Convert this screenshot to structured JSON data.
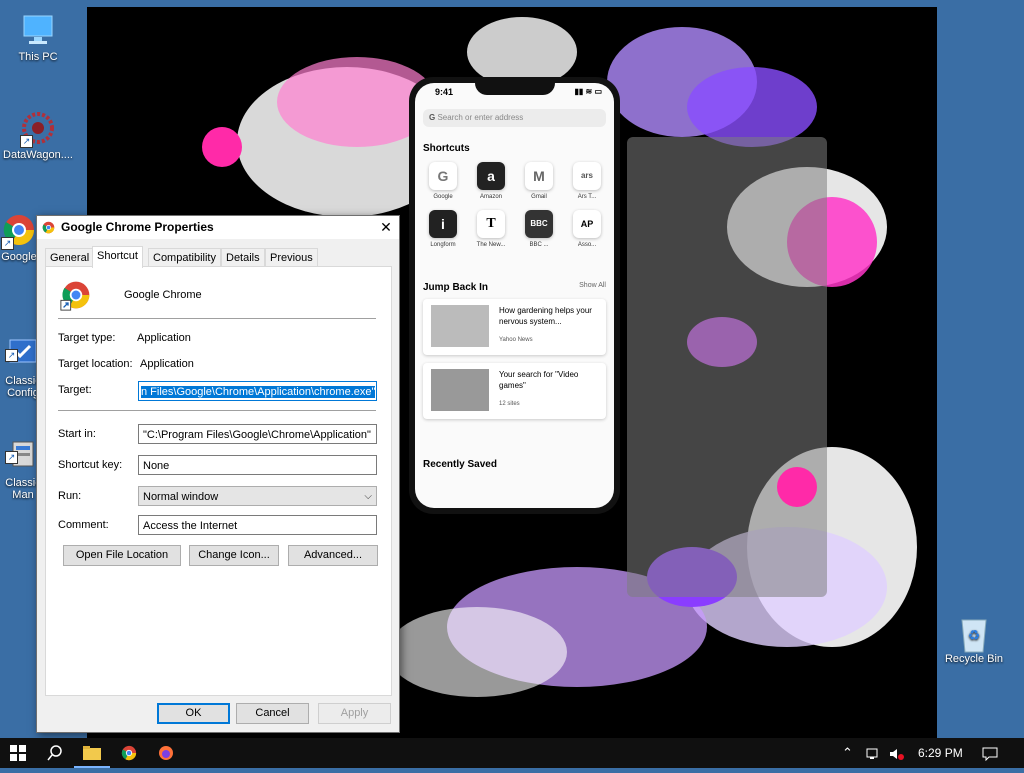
{
  "desktop": {
    "icons": [
      {
        "label": "This PC"
      },
      {
        "label": "DataWagon...."
      },
      {
        "label": "Google"
      },
      {
        "label": "Classic\nConfig"
      },
      {
        "label": "Classic\nMan"
      },
      {
        "label": "Recycle Bin"
      }
    ]
  },
  "phone": {
    "time": "9:41",
    "search_placeholder": "Search or enter address",
    "shortcuts_heading": "Shortcuts",
    "shortcuts": [
      {
        "glyph": "G",
        "label": "Google"
      },
      {
        "glyph": "a",
        "label": "Amazon"
      },
      {
        "glyph": "M",
        "label": "Gmail"
      },
      {
        "glyph": "ars",
        "label": "Ars T..."
      },
      {
        "glyph": "i",
        "label": "Longform"
      },
      {
        "glyph": "T",
        "label": "The New..."
      },
      {
        "glyph": "BBC",
        "label": "BBC ..."
      },
      {
        "glyph": "AP",
        "label": "Asso..."
      }
    ],
    "jump_back_heading": "Jump Back In",
    "show_all": "Show All",
    "cards": [
      {
        "title": "How gardening helps your nervous system...",
        "source": "Yahoo News"
      },
      {
        "title": "Your search for \"Video games\"",
        "source": "12 sites"
      }
    ],
    "recently_saved": "Recently Saved"
  },
  "dialog": {
    "title": "Google Chrome Properties",
    "tabs": [
      "General",
      "Shortcut",
      "Compatibility",
      "Details",
      "Previous Versions"
    ],
    "active_tab": "Shortcut",
    "app_name": "Google Chrome",
    "target_type_label": "Target type:",
    "target_type_value": "Application",
    "target_location_label": "Target location:",
    "target_location_value": "Application",
    "target_label": "Target:",
    "target_value": "n Files\\Google\\Chrome\\Application\\chrome.exe\"",
    "start_in_label": "Start in:",
    "start_in_value": "\"C:\\Program Files\\Google\\Chrome\\Application\"",
    "shortcut_key_label": "Shortcut key:",
    "shortcut_key_value": "None",
    "run_label": "Run:",
    "run_value": "Normal window",
    "comment_label": "Comment:",
    "comment_value": "Access the Internet",
    "open_file_location": "Open File Location",
    "change_icon": "Change Icon...",
    "advanced": "Advanced...",
    "ok": "OK",
    "cancel": "Cancel",
    "apply": "Apply"
  },
  "taskbar": {
    "clock": "6:29 PM"
  },
  "colors": {
    "desktop": "#3a6ea5",
    "selection": "#0078d7",
    "accent_pink": "#ff3fb4",
    "accent_purple": "#9b5cf5"
  }
}
